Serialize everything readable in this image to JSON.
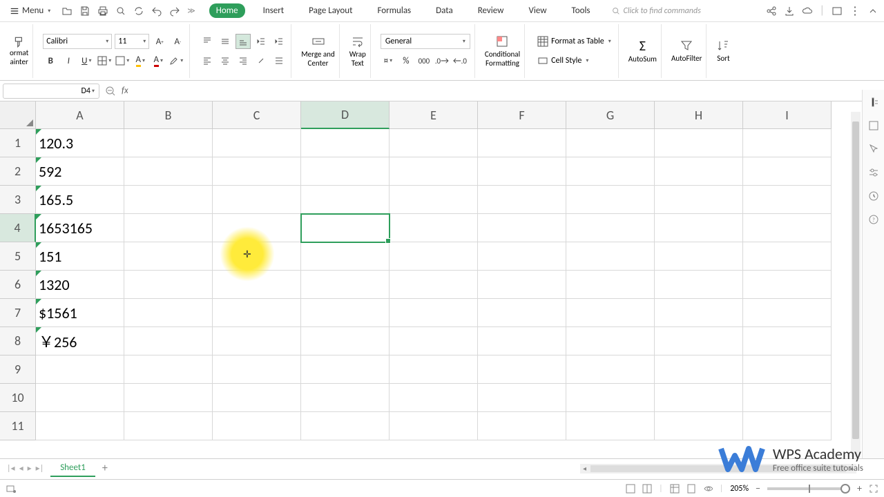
{
  "menubar": {
    "menu_label": "Menu",
    "tabs": [
      "Home",
      "Insert",
      "Page Layout",
      "Formulas",
      "Data",
      "Review",
      "View",
      "Tools"
    ],
    "active_tab": 0,
    "search_placeholder": "Click to find commands"
  },
  "ribbon": {
    "format_painter_line1": "ormat",
    "format_painter_line2": "ainter",
    "font_name": "Calibri",
    "font_size": "11",
    "merge_label": "Merge and\nCenter",
    "wrap_label": "Wrap\nText",
    "number_format": "General",
    "cond_format": "Conditional\nFormatting",
    "format_table": "Format as Table",
    "cell_style": "Cell Style",
    "autosum": "AutoSum",
    "autofilter": "AutoFilter",
    "sort": "Sort"
  },
  "formula_bar": {
    "name_box": "D4",
    "fx": "fx",
    "formula": ""
  },
  "grid": {
    "columns": [
      "A",
      "B",
      "C",
      "D",
      "E",
      "F",
      "G",
      "H",
      "I"
    ],
    "rows": [
      "1",
      "2",
      "3",
      "4",
      "5",
      "6",
      "7",
      "8",
      "9",
      "10",
      "11"
    ],
    "active_col": 3,
    "active_row": 3,
    "cells": {
      "A1": "120.3",
      "A2": "592",
      "A3": "165.5",
      "A4": "1653165",
      "A5": "151",
      "A6": "1320",
      "A7": "$1561",
      "A8": "￥256"
    },
    "selected": "D4",
    "highlight_pos": {
      "col": "C",
      "between_rows": "4-5"
    }
  },
  "sheets": {
    "active": "Sheet1"
  },
  "status": {
    "zoom": "205%"
  },
  "watermark": {
    "title": "WPS Academy",
    "sub": "Free office suite tutorials"
  }
}
